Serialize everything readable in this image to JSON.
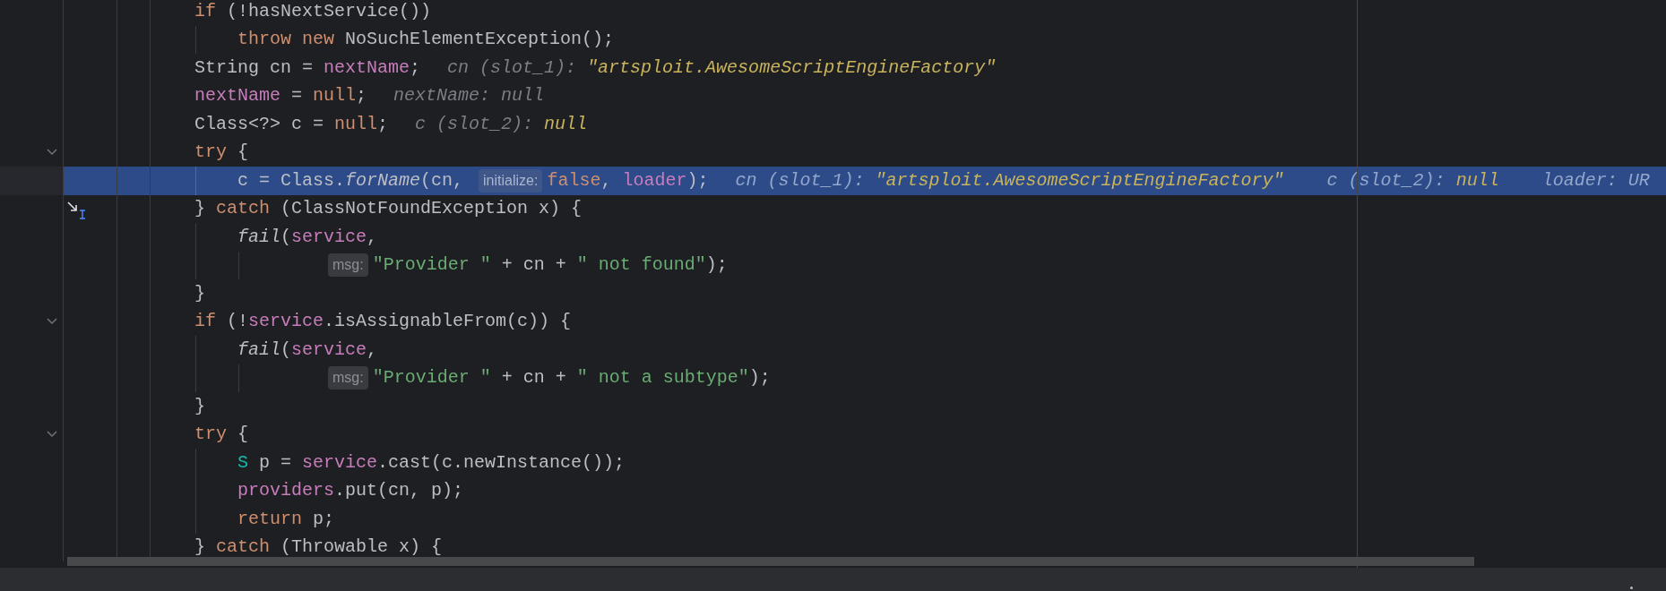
{
  "lines": [
    {
      "selected": false,
      "fold": false,
      "pointer": false,
      "segments": [
        {
          "kind": "code",
          "tokens": [
            {
              "text": "if",
              "kind": "keyword"
            },
            {
              "text": " (!hasNextService())",
              "kind": "plain"
            }
          ]
        }
      ]
    },
    {
      "selected": false,
      "fold": false,
      "pointer": false,
      "segments": [
        {
          "kind": "code",
          "tokens": [
            {
              "text": "    throw new",
              "kind": "keyword"
            },
            {
              "text": " NoSuchElementException();",
              "kind": "plain"
            }
          ]
        }
      ]
    },
    {
      "selected": false,
      "fold": false,
      "pointer": false,
      "segments": [
        {
          "kind": "code",
          "tokens": [
            {
              "text": "String cn = ",
              "kind": "plain"
            },
            {
              "text": "nextName",
              "kind": "field"
            },
            {
              "text": ";",
              "kind": "plain"
            }
          ]
        },
        {
          "kind": "value",
          "tokens": [
            {
              "text": "cn (slot_1): ",
              "kind": "name"
            },
            {
              "text": "\"artsploit.AwesomeScriptEngineFactory\"",
              "kind": "value"
            }
          ]
        }
      ]
    },
    {
      "selected": false,
      "fold": false,
      "pointer": false,
      "segments": [
        {
          "kind": "code",
          "tokens": [
            {
              "text": "nextName",
              "kind": "field"
            },
            {
              "text": " = ",
              "kind": "plain"
            },
            {
              "text": "null",
              "kind": "keyword"
            },
            {
              "text": ";",
              "kind": "plain"
            }
          ]
        },
        {
          "kind": "value",
          "tokens": [
            {
              "text": "nextName: null",
              "kind": "name"
            }
          ]
        }
      ]
    },
    {
      "selected": false,
      "fold": false,
      "pointer": false,
      "segments": [
        {
          "kind": "code",
          "tokens": [
            {
              "text": "Class<?> c = ",
              "kind": "plain"
            },
            {
              "text": "null",
              "kind": "keyword"
            },
            {
              "text": ";",
              "kind": "plain"
            }
          ]
        },
        {
          "kind": "value",
          "tokens": [
            {
              "text": "c (slot_2): ",
              "kind": "name"
            },
            {
              "text": "null",
              "kind": "value"
            }
          ]
        }
      ]
    },
    {
      "selected": false,
      "fold": true,
      "pointer": false,
      "segments": [
        {
          "kind": "code",
          "tokens": [
            {
              "text": "try",
              "kind": "keyword"
            },
            {
              "text": " {",
              "kind": "plain"
            }
          ]
        }
      ]
    },
    {
      "selected": true,
      "fold": false,
      "pointer": false,
      "segments": [
        {
          "kind": "code",
          "tokens": [
            {
              "text": "    c = Class.",
              "kind": "plain"
            },
            {
              "text": "forName",
              "kind": "static"
            },
            {
              "text": "(cn, ",
              "kind": "plain"
            }
          ]
        },
        {
          "kind": "hint",
          "text": "initialize:"
        },
        {
          "kind": "code",
          "tokens": [
            {
              "text": "false",
              "kind": "keyword"
            },
            {
              "text": ", ",
              "kind": "plain"
            },
            {
              "text": "loader",
              "kind": "field"
            },
            {
              "text": ");",
              "kind": "plain"
            }
          ]
        },
        {
          "kind": "value",
          "tokens": [
            {
              "text": "cn (slot_1): ",
              "kind": "name"
            },
            {
              "text": "\"artsploit.AwesomeScriptEngineFactory\"",
              "kind": "value"
            }
          ]
        },
        {
          "kind": "value",
          "tokens": [
            {
              "text": "c (slot_2): ",
              "kind": "name"
            },
            {
              "text": "null",
              "kind": "value"
            }
          ]
        },
        {
          "kind": "value",
          "tokens": [
            {
              "text": "loader: UR",
              "kind": "name"
            }
          ]
        }
      ]
    },
    {
      "selected": false,
      "fold": false,
      "pointer": true,
      "segments": [
        {
          "kind": "code",
          "tokens": [
            {
              "text": "} ",
              "kind": "plain"
            },
            {
              "text": "catch",
              "kind": "keyword"
            },
            {
              "text": " (ClassNotFoundException x) {",
              "kind": "plain"
            }
          ]
        }
      ]
    },
    {
      "selected": false,
      "fold": false,
      "pointer": false,
      "segments": [
        {
          "kind": "code",
          "tokens": [
            {
              "text": "    fail",
              "kind": "static"
            },
            {
              "text": "(",
              "kind": "plain"
            },
            {
              "text": "service",
              "kind": "field"
            },
            {
              "text": ",",
              "kind": "plain"
            }
          ]
        }
      ]
    },
    {
      "selected": false,
      "fold": false,
      "pointer": false,
      "continuation": true,
      "segments": [
        {
          "kind": "hint",
          "text": "msg:"
        },
        {
          "kind": "code",
          "tokens": [
            {
              "text": "\"Provider \"",
              "kind": "string"
            },
            {
              "text": " + cn + ",
              "kind": "plain"
            },
            {
              "text": "\" not found\"",
              "kind": "string"
            },
            {
              "text": ");",
              "kind": "plain"
            }
          ]
        }
      ]
    },
    {
      "selected": false,
      "fold": false,
      "pointer": false,
      "segments": [
        {
          "kind": "code",
          "tokens": [
            {
              "text": "}",
              "kind": "plain"
            }
          ]
        }
      ]
    },
    {
      "selected": false,
      "fold": true,
      "pointer": false,
      "segments": [
        {
          "kind": "code",
          "tokens": [
            {
              "text": "if",
              "kind": "keyword"
            },
            {
              "text": " (!",
              "kind": "plain"
            },
            {
              "text": "service",
              "kind": "field"
            },
            {
              "text": ".isAssignableFrom(c)) {",
              "kind": "plain"
            }
          ]
        }
      ]
    },
    {
      "selected": false,
      "fold": false,
      "pointer": false,
      "segments": [
        {
          "kind": "code",
          "tokens": [
            {
              "text": "    fail",
              "kind": "static"
            },
            {
              "text": "(",
              "kind": "plain"
            },
            {
              "text": "service",
              "kind": "field"
            },
            {
              "text": ",",
              "kind": "plain"
            }
          ]
        }
      ]
    },
    {
      "selected": false,
      "fold": false,
      "pointer": false,
      "continuation": true,
      "segments": [
        {
          "kind": "hint",
          "text": "msg:"
        },
        {
          "kind": "code",
          "tokens": [
            {
              "text": "\"Provider \"",
              "kind": "string"
            },
            {
              "text": " + cn + ",
              "kind": "plain"
            },
            {
              "text": "\" not a subtype\"",
              "kind": "string"
            },
            {
              "text": ");",
              "kind": "plain"
            }
          ]
        }
      ]
    },
    {
      "selected": false,
      "fold": false,
      "pointer": false,
      "segments": [
        {
          "kind": "code",
          "tokens": [
            {
              "text": "}",
              "kind": "plain"
            }
          ]
        }
      ]
    },
    {
      "selected": false,
      "fold": true,
      "pointer": false,
      "segments": [
        {
          "kind": "code",
          "tokens": [
            {
              "text": "try",
              "kind": "keyword"
            },
            {
              "text": " {",
              "kind": "plain"
            }
          ]
        }
      ]
    },
    {
      "selected": false,
      "fold": false,
      "pointer": false,
      "segments": [
        {
          "kind": "code",
          "tokens": [
            {
              "text": "    S",
              "kind": "type"
            },
            {
              "text": " p = ",
              "kind": "plain"
            },
            {
              "text": "service",
              "kind": "field"
            },
            {
              "text": ".cast(c.newInstance());",
              "kind": "plain"
            }
          ]
        }
      ]
    },
    {
      "selected": false,
      "fold": false,
      "pointer": false,
      "segments": [
        {
          "kind": "code",
          "tokens": [
            {
              "text": "    providers",
              "kind": "field"
            },
            {
              "text": ".put(cn, p);",
              "kind": "plain"
            }
          ]
        }
      ]
    },
    {
      "selected": false,
      "fold": false,
      "pointer": false,
      "segments": [
        {
          "kind": "code",
          "tokens": [
            {
              "text": "    return",
              "kind": "keyword"
            },
            {
              "text": " p;",
              "kind": "plain"
            }
          ]
        }
      ]
    },
    {
      "selected": false,
      "fold": false,
      "pointer": false,
      "segments": [
        {
          "kind": "code",
          "tokens": [
            {
              "text": "} ",
              "kind": "plain"
            },
            {
              "text": "catch",
              "kind": "keyword"
            },
            {
              "text": " (Throwable x) {",
              "kind": "plain"
            }
          ]
        }
      ]
    }
  ]
}
